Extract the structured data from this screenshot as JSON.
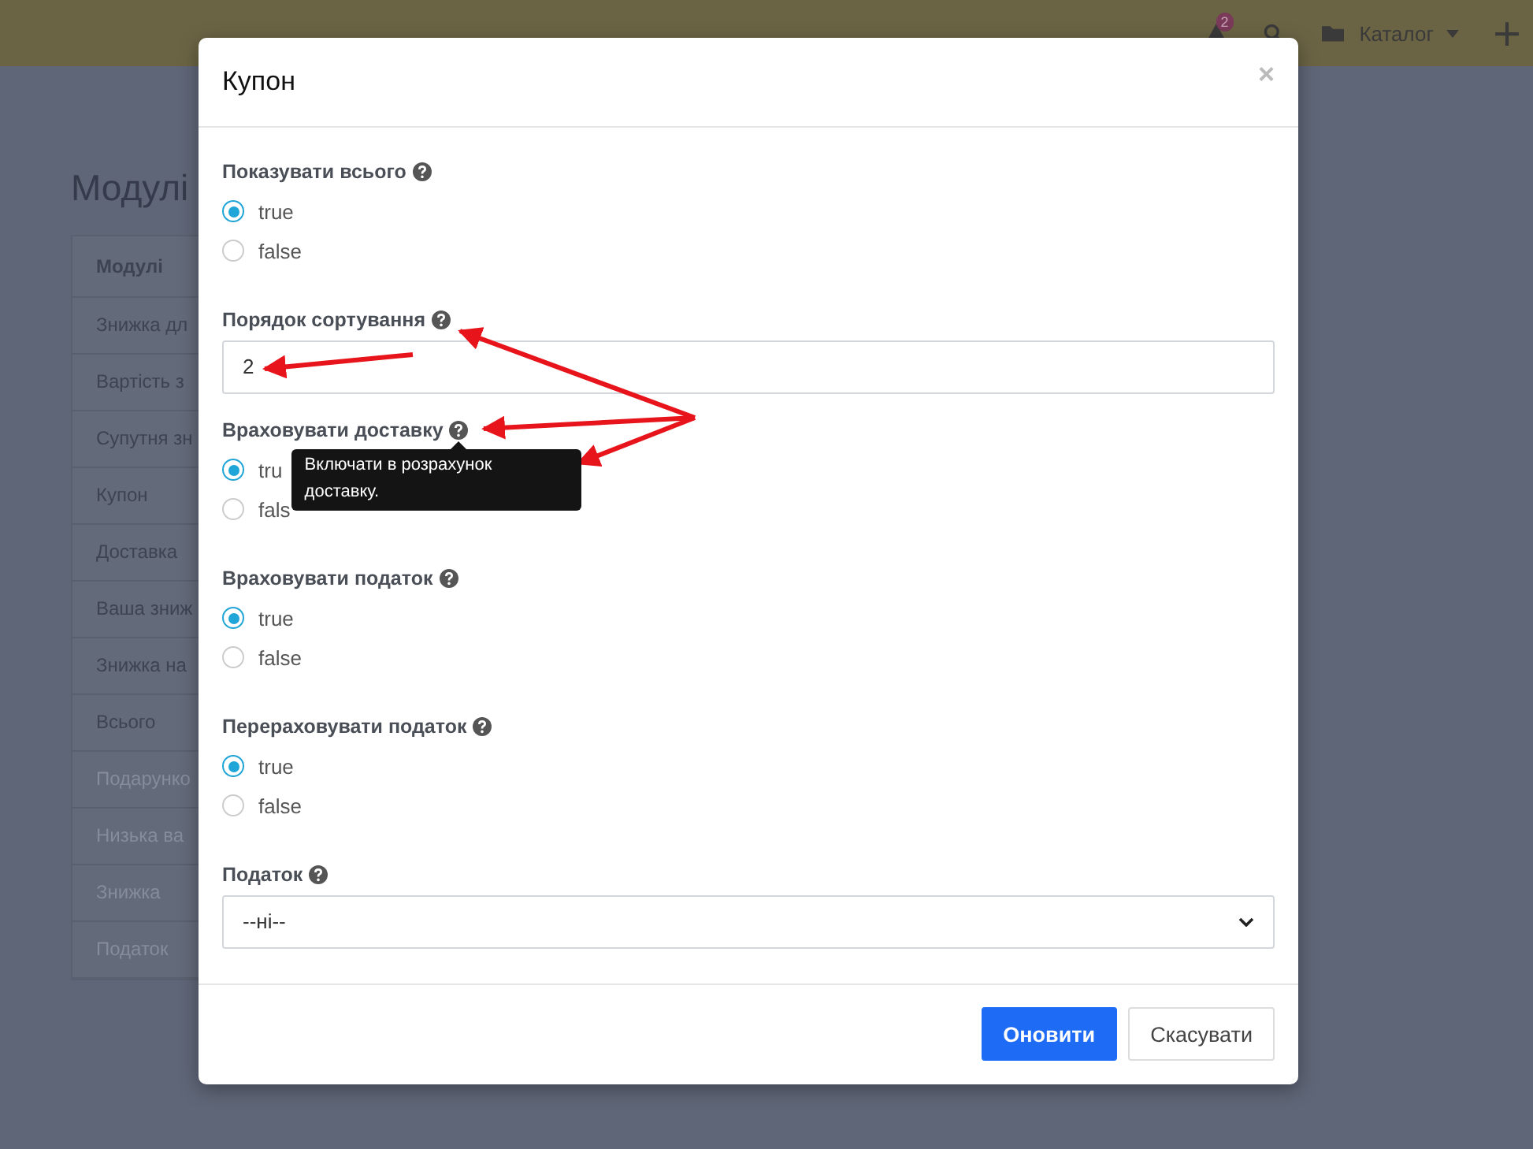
{
  "topbar": {
    "notification_count": "2",
    "menu_label": "Каталог"
  },
  "page": {
    "title": "Модулі",
    "table": {
      "columns": [
        "Модулі"
      ],
      "rows": [
        {
          "cell": "Знижка дл",
          "disabled": false
        },
        {
          "cell": "Вартість з",
          "disabled": false
        },
        {
          "cell": "Супутня зн",
          "disabled": false
        },
        {
          "cell": "Купон",
          "disabled": false
        },
        {
          "cell": "Доставка",
          "disabled": false
        },
        {
          "cell": "Ваша зниж",
          "disabled": false
        },
        {
          "cell": "Знижка на",
          "disabled": false
        },
        {
          "cell": "Всього",
          "disabled": false
        },
        {
          "cell": "Подарунко",
          "disabled": true
        },
        {
          "cell": "Низька ва",
          "disabled": true
        },
        {
          "cell": "Знижка",
          "disabled": true
        },
        {
          "cell": "Податок",
          "disabled": true
        }
      ]
    }
  },
  "modal": {
    "title": "Купон",
    "close": "×",
    "fields": [
      {
        "kind": "radio",
        "label": "Показувати всього",
        "options": [
          {
            "label": "true",
            "selected": true
          },
          {
            "label": "false",
            "selected": false
          }
        ]
      },
      {
        "kind": "text",
        "label": "Порядок сортування",
        "value": "2"
      },
      {
        "kind": "radio",
        "label": "Враховувати доставку",
        "tooltip": "Включати в розрахунок доставку.",
        "options": [
          {
            "label": "tru",
            "selected": true
          },
          {
            "label": "fals",
            "selected": false
          }
        ]
      },
      {
        "kind": "radio",
        "label": "Враховувати податок",
        "options": [
          {
            "label": "true",
            "selected": true
          },
          {
            "label": "false",
            "selected": false
          }
        ]
      },
      {
        "kind": "radio",
        "label": "Перераховувати податок",
        "options": [
          {
            "label": "true",
            "selected": true
          },
          {
            "label": "false",
            "selected": false
          }
        ]
      },
      {
        "kind": "select",
        "label": "Податок",
        "value": "--ні--"
      }
    ],
    "buttons": [
      {
        "label": "Оновити",
        "kind": "primary"
      },
      {
        "label": "Скасувати",
        "kind": "secondary"
      }
    ]
  }
}
